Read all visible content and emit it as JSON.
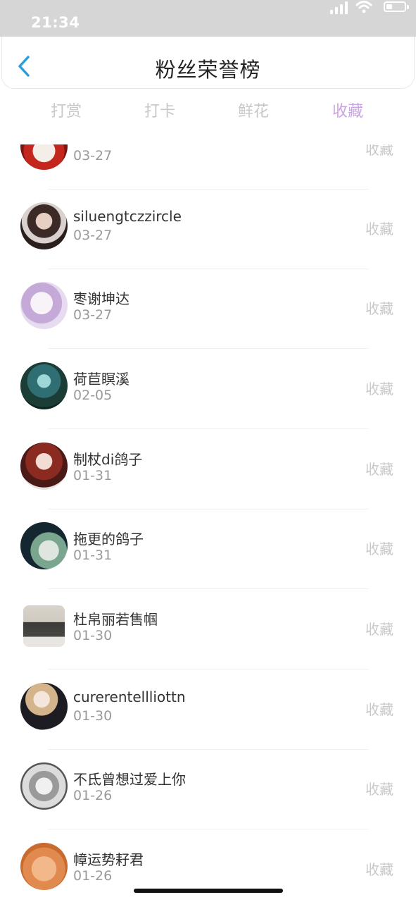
{
  "status_bar": {
    "time": "21:34",
    "icons": [
      "signal-icon",
      "wifi-icon",
      "battery-icon"
    ]
  },
  "header": {
    "title": "粉丝荣誉榜",
    "back_icon": "chevron-left-icon"
  },
  "tabs": [
    {
      "label": "打赏",
      "active": false
    },
    {
      "label": "打卡",
      "active": false
    },
    {
      "label": "鲜花",
      "active": false
    },
    {
      "label": "收藏",
      "active": true
    }
  ],
  "colors": {
    "active_tab": "#c9a3e3",
    "back_icon": "#2a9fd8",
    "muted": "#c8c8c8"
  },
  "list": [
    {
      "name": "",
      "date": "03-27",
      "action": "收藏"
    },
    {
      "name": "siluengtczzircle",
      "date": "03-27",
      "action": "收藏"
    },
    {
      "name": "枣谢坤达",
      "date": "03-27",
      "action": "收藏"
    },
    {
      "name": "荷苣瞑溪",
      "date": "02-05",
      "action": "收藏"
    },
    {
      "name": "制杖di鸽子",
      "date": "01-31",
      "action": "收藏"
    },
    {
      "name": "拖更的鸽子",
      "date": "01-31",
      "action": "收藏"
    },
    {
      "name": "杜帛丽若售帼",
      "date": "01-30",
      "action": "收藏"
    },
    {
      "name": "curerentellliottn",
      "date": "01-30",
      "action": "收藏"
    },
    {
      "name": "不氐曾想过爱上你",
      "date": "01-26",
      "action": "收藏"
    },
    {
      "name": "幛运势耔君",
      "date": "01-26",
      "action": "收藏"
    }
  ]
}
